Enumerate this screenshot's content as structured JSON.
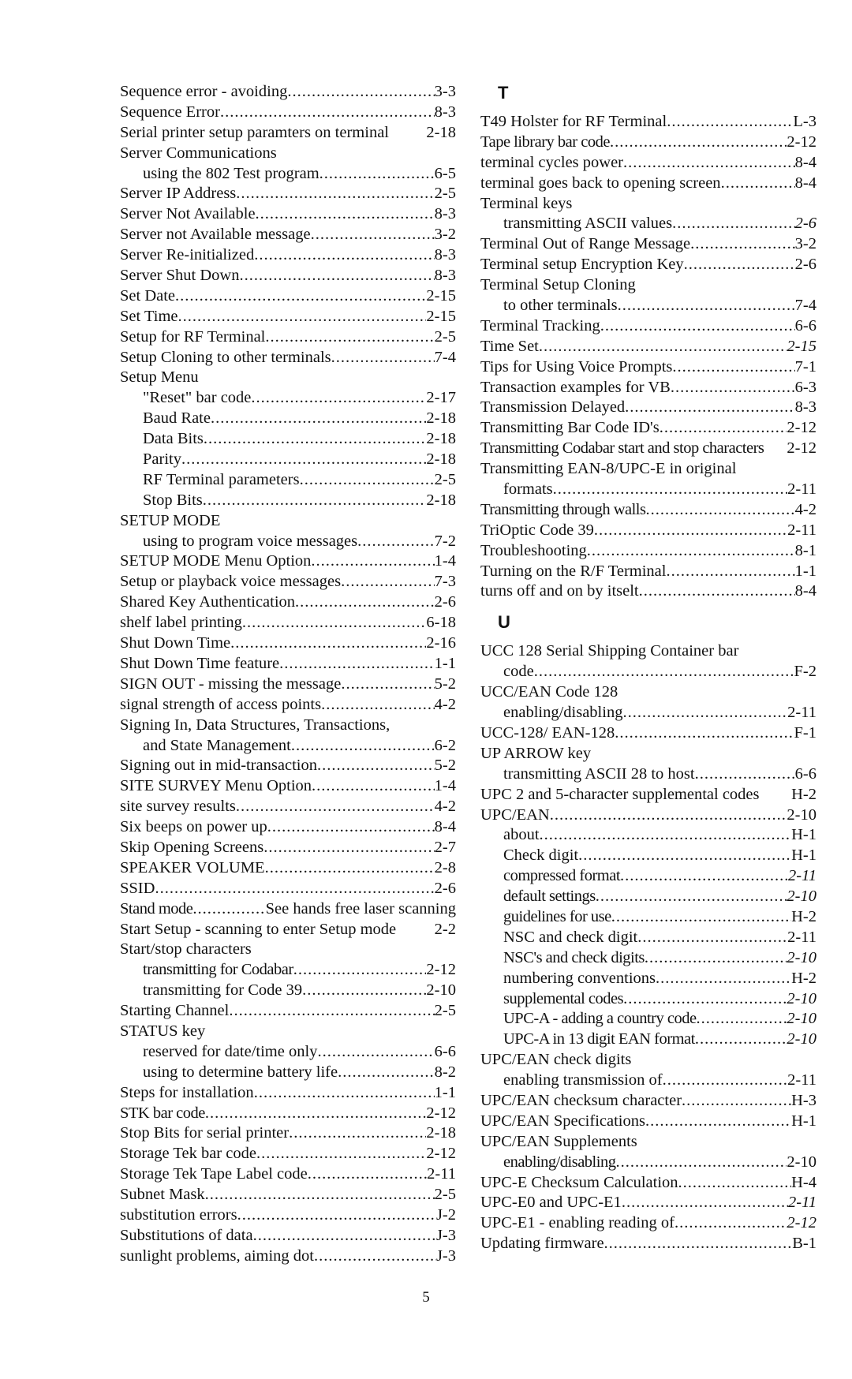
{
  "page_number": "5",
  "left_column": [
    {
      "term": "Sequence error - avoiding",
      "page": "3-3"
    },
    {
      "term": "Sequence Error",
      "page": "8-3"
    },
    {
      "term": "Serial printer setup paramters on terminal",
      "page": "2-18",
      "no_leader": true
    },
    {
      "term": "Server Communications",
      "page": ""
    },
    {
      "term": "using the 802 Test program",
      "page": "6-5",
      "indent": true
    },
    {
      "term": "Server IP Address",
      "page": "2-5"
    },
    {
      "term": "Server Not Available",
      "page": "8-3"
    },
    {
      "term": "Server not Available message",
      "page": "3-2"
    },
    {
      "term": "Server Re-initialized",
      "page": "8-3"
    },
    {
      "term": "Server Shut Down",
      "page": "8-3"
    },
    {
      "term": "Set Date",
      "page": "2-15"
    },
    {
      "term": "Set Time",
      "page": "2-15"
    },
    {
      "term": "Setup for RF Terminal",
      "page": "2-5"
    },
    {
      "term": "Setup Cloning to other terminals",
      "page": "7-4"
    },
    {
      "term": "Setup Menu",
      "page": ""
    },
    {
      "term": "\"Reset\" bar code",
      "page": "2-17",
      "indent": true
    },
    {
      "term": "Baud Rate",
      "page": "2-18",
      "indent": true
    },
    {
      "term": "Data Bits",
      "page": "2-18",
      "indent": true
    },
    {
      "term": "Parity",
      "page": "2-18",
      "indent": true
    },
    {
      "term": "RF Terminal parameters",
      "page": "2-5",
      "indent": true
    },
    {
      "term": "Stop Bits",
      "page": "2-18",
      "indent": true
    },
    {
      "term": "SETUP MODE",
      "page": ""
    },
    {
      "term": "using to program voice messages",
      "page": "7-2",
      "indent": true
    },
    {
      "term": "SETUP MODE Menu Option",
      "page": "1-4"
    },
    {
      "term": "Setup or playback voice messages",
      "page": "7-3"
    },
    {
      "term": "Shared Key Authentication",
      "page": "2-6"
    },
    {
      "term": "shelf label printing",
      "page": "6-18"
    },
    {
      "term": "Shut Down Time",
      "page": "2-16"
    },
    {
      "term": "Shut Down Time feature",
      "page": "1-1"
    },
    {
      "term": "SIGN OUT - missing the message",
      "page": "5-2"
    },
    {
      "term": "signal strength of access points",
      "page": "4-2"
    },
    {
      "term": "Signing In, Data Structures, Transactions,",
      "page": ""
    },
    {
      "term": "and State Management",
      "page": "6-2",
      "indent": true
    },
    {
      "term": "Signing out in mid-transaction",
      "page": "5-2"
    },
    {
      "term": "SITE SURVEY Menu Option",
      "page": "1-4"
    },
    {
      "term": "site survey results",
      "page": "4-2"
    },
    {
      "term": "Six beeps on power up",
      "page": "8-4"
    },
    {
      "term": "Skip Opening Screens",
      "page": "2-7"
    },
    {
      "term": "SPEAKER VOLUME",
      "page": "2-8"
    },
    {
      "term": "SSID",
      "page": "2-6"
    },
    {
      "term": "Stand mode",
      "page": "See hands free laser scanning",
      "narrow": true
    },
    {
      "term": "Start Setup - scanning to enter Setup mode",
      "page": "2-2",
      "no_leader": true
    },
    {
      "term": "Start/stop characters",
      "page": ""
    },
    {
      "term": "transmitting for Codabar",
      "page": "2-12",
      "indent": true,
      "narrow": true
    },
    {
      "term": "transmitting for Code 39",
      "page": "2-10",
      "indent": true
    },
    {
      "term": "Starting Channel",
      "page": "2-5"
    },
    {
      "term": "STATUS key",
      "page": ""
    },
    {
      "term": "reserved for date/time only",
      "page": "6-6",
      "indent": true
    },
    {
      "term": "using to determine battery life",
      "page": "8-2",
      "indent": true
    },
    {
      "term": "Steps for installation",
      "page": "1-1"
    },
    {
      "term": "STK bar code",
      "page": "2-12",
      "narrow": true
    },
    {
      "term": "Stop Bits for serial printer",
      "page": "2-18"
    },
    {
      "term": "Storage Tek bar code",
      "page": "2-12"
    },
    {
      "term": "Storage Tek Tape Label code",
      "page": "2-11"
    },
    {
      "term": "Subnet Mask",
      "page": "2-5"
    },
    {
      "term": "substitution errors",
      "page": "J-2"
    },
    {
      "term": "Substitutions of data",
      "page": "J-3"
    },
    {
      "term": "sunlight problems, aiming dot",
      "page": "J-3"
    }
  ],
  "right_column": {
    "sections": [
      {
        "letter": "T",
        "entries": [
          {
            "term": "T49 Holster for RF Terminal",
            "page": "L-3"
          },
          {
            "term": "Tape library bar code",
            "page": "2-12",
            "narrow": true
          },
          {
            "term": "terminal cycles power",
            "page": "8-4"
          },
          {
            "term": "terminal goes back to opening screen",
            "page": "8-4"
          },
          {
            "term": "Terminal keys",
            "page": ""
          },
          {
            "term": "transmitting ASCII values",
            "page": "2-6",
            "indent": true,
            "italic": true
          },
          {
            "term": "Terminal Out of Range Message",
            "page": "3-2"
          },
          {
            "term": "Terminal setup Encryption Key",
            "page": "2-6"
          },
          {
            "term": "Terminal Setup Cloning",
            "page": ""
          },
          {
            "term": "to other terminals",
            "page": "7-4",
            "indent": true
          },
          {
            "term": "Terminal Tracking",
            "page": "6-6"
          },
          {
            "term": "Time Set",
            "page": "2-15",
            "italic": true
          },
          {
            "term": "Tips for Using Voice Prompts",
            "page": "7-1"
          },
          {
            "term": "Transaction examples for VB",
            "page": "6-3"
          },
          {
            "term": "Transmission Delayed",
            "page": "8-3"
          },
          {
            "term": "Transmitting Bar Code ID's",
            "page": "2-12"
          },
          {
            "term": "Transmitting Codabar start and stop characters",
            "page": "2-12",
            "no_leader": true,
            "narrow": true
          },
          {
            "term": "Transmitting EAN-8/UPC-E in original",
            "page": ""
          },
          {
            "term": "formats",
            "page": "2-11",
            "indent": true
          },
          {
            "term": "Transmitting through walls",
            "page": "4-2",
            "narrow": true
          },
          {
            "term": "TriOptic Code 39",
            "page": "2-11"
          },
          {
            "term": "Troubleshooting",
            "page": "8-1"
          },
          {
            "term": "Turning on the R/F Terminal",
            "page": "1-1"
          },
          {
            "term": "turns off and on by itselt",
            "page": "8-4"
          }
        ]
      },
      {
        "letter": "U",
        "entries": [
          {
            "term": "UCC 128 Serial Shipping Container bar",
            "page": ""
          },
          {
            "term": "code",
            "page": "F-2",
            "indent": true
          },
          {
            "term": "UCC/EAN Code 128",
            "page": ""
          },
          {
            "term": "enabling/disabling",
            "page": "2-11",
            "indent": true
          },
          {
            "term": "UCC-128/ EAN-128",
            "page": "F-1"
          },
          {
            "term": "UP ARROW key",
            "page": ""
          },
          {
            "term": "transmitting ASCII 28 to host",
            "page": "6-6",
            "indent": true
          },
          {
            "term": "UPC 2 and 5-character supplemental codes",
            "page": "H-2",
            "no_leader": true
          },
          {
            "term": "UPC/EAN",
            "page": "2-10"
          },
          {
            "term": "about",
            "page": "H-1",
            "indent": true
          },
          {
            "term": "Check digit",
            "page": "H-1",
            "indent": true
          },
          {
            "term": "compressed format",
            "page": "2-11",
            "indent": true,
            "italic": true,
            "narrow": true
          },
          {
            "term": "default settings",
            "page": "2-10",
            "indent": true,
            "italic": true,
            "narrow": true
          },
          {
            "term": "guidelines for use",
            "page": "H-2",
            "indent": true,
            "narrow": true
          },
          {
            "term": "NSC and check digit",
            "page": "2-11",
            "indent": true
          },
          {
            "term": "NSC's and check digits",
            "page": "2-10",
            "indent": true,
            "italic": true,
            "narrow": true
          },
          {
            "term": "numbering conventions",
            "page": "H-2",
            "indent": true
          },
          {
            "term": "supplemental codes",
            "page": "2-10",
            "indent": true,
            "italic": true,
            "narrow": true
          },
          {
            "term": "UPC-A - adding a country code",
            "page": "2-10",
            "indent": true,
            "italic": true,
            "narrow": true
          },
          {
            "term": "UPC-A in 13 digit EAN format",
            "page": "2-10",
            "indent": true,
            "italic": true,
            "narrow": true
          },
          {
            "term": "UPC/EAN check digits",
            "page": ""
          },
          {
            "term": "enabling transmission of",
            "page": "2-11",
            "indent": true
          },
          {
            "term": "UPC/EAN checksum character",
            "page": "H-3"
          },
          {
            "term": "UPC/EAN Specifications",
            "page": "H-1"
          },
          {
            "term": "UPC/EAN Supplements",
            "page": ""
          },
          {
            "term": "enabling/disabling",
            "page": "2-10",
            "indent": true,
            "narrow": true
          },
          {
            "term": "UPC-E Checksum Calculation",
            "page": "H-4"
          },
          {
            "term": "UPC-E0 and UPC-E1",
            "page": "2-11",
            "italic": true
          },
          {
            "term": "UPC-E1 - enabling reading of",
            "page": "2-12",
            "italic": true
          },
          {
            "term": "Updating firmware",
            "page": "B-1"
          }
        ]
      }
    ]
  }
}
